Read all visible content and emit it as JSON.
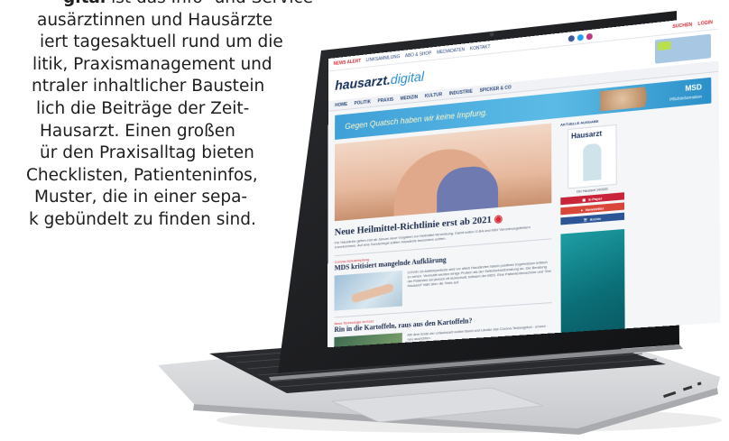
{
  "copy": {
    "lines": [
      {
        "bold": "gital",
        "text": " ist das Info- und Service-"
      },
      {
        "text": "ausärztinnen und Hausärzte"
      },
      {
        "text": "iert tagesaktuell rund um die"
      },
      {
        "text": "litik, Praxismanagement und"
      },
      {
        "text": "ntraler inhaltlicher Baustein"
      },
      {
        "text": "lich die Beiträge der Zeit-"
      },
      {
        "text": "Hausarzt. Einen großen"
      },
      {
        "text": "ür den Praxisalltag bieten"
      },
      {
        "text": " Checklisten, Patienteninfos,"
      },
      {
        "text": "Muster, die in einer sepa-"
      },
      {
        "text": "k gebündelt zu finden sind."
      }
    ]
  },
  "site": {
    "topbar": {
      "news": "NEWS ALERT",
      "links": [
        "LINKSAMMLUNG",
        "ABO & SHOP",
        "MEDIADATEN",
        "KONTAKT"
      ],
      "search": "SUCHEN",
      "login": "LOGIN"
    },
    "logo": {
      "main": "hausarzt.",
      "suffix": "digital"
    },
    "nav": [
      "HOME",
      "POLITIK",
      "PRAXIS",
      "MEDIZIN",
      "KULTUR",
      "INDUSTRIE",
      "SPICKER & CO"
    ],
    "banner": {
      "text": "Gegen Quatsch haben wir keine Impfung.",
      "brand": "MSD",
      "sub": "Pflichtinformation"
    },
    "hero": {
      "title": "Neue Heilmittel-Richtlinie erst ab 2021",
      "text": "Für Hausärzte gelten erst ab Januar neue Vorgaben zur Heilmittel-Verordnung. Damit sollen G-BA und KBV Verordnungsfehlern zuvorkommen. Auf eine Sonderregel sollten Hausärzte besonders achten."
    },
    "article1": {
      "kicker": "Corona-Schutzimpfung",
      "title": "MDS kritisiert mangelnde Aufklärung",
      "text": "COVID-19-Antikörpertests sind vor allem Hausärzten falsch positiven Ergebnissen kritisch zu sehen. Vermutet werden einige Proben als der Selbstschutzberatung an. Die Beratung der Patienten sei jedoch oft lückenhaft, kritisiert der MDS. Eine Patientenbroschüre und \"Der Hausarzt\" klärt über die Tests auf."
    },
    "article2": {
      "kicker": "Neue Technologie im Kurs",
      "title": "Rin in die Kartoffeln, raus aus den Kartoffeln?",
      "text": "Mit dem Ende der Urlaubszeit wollen Bund und Länder das Corona-Testangebot - erneut - neu ausrichten."
    },
    "sidebar": {
      "heading": "AKTUELLE AUSGABE",
      "mag_title": "Hausarzt",
      "mag_caption": "Der Hausarzt 14/2020",
      "buttons": [
        "E-Paper",
        "Newsletter",
        "Archiv"
      ]
    }
  },
  "colors": {
    "brand_blue": "#16305c",
    "accent_red": "#d92a35",
    "banner_blue": "#3fa0d8"
  }
}
